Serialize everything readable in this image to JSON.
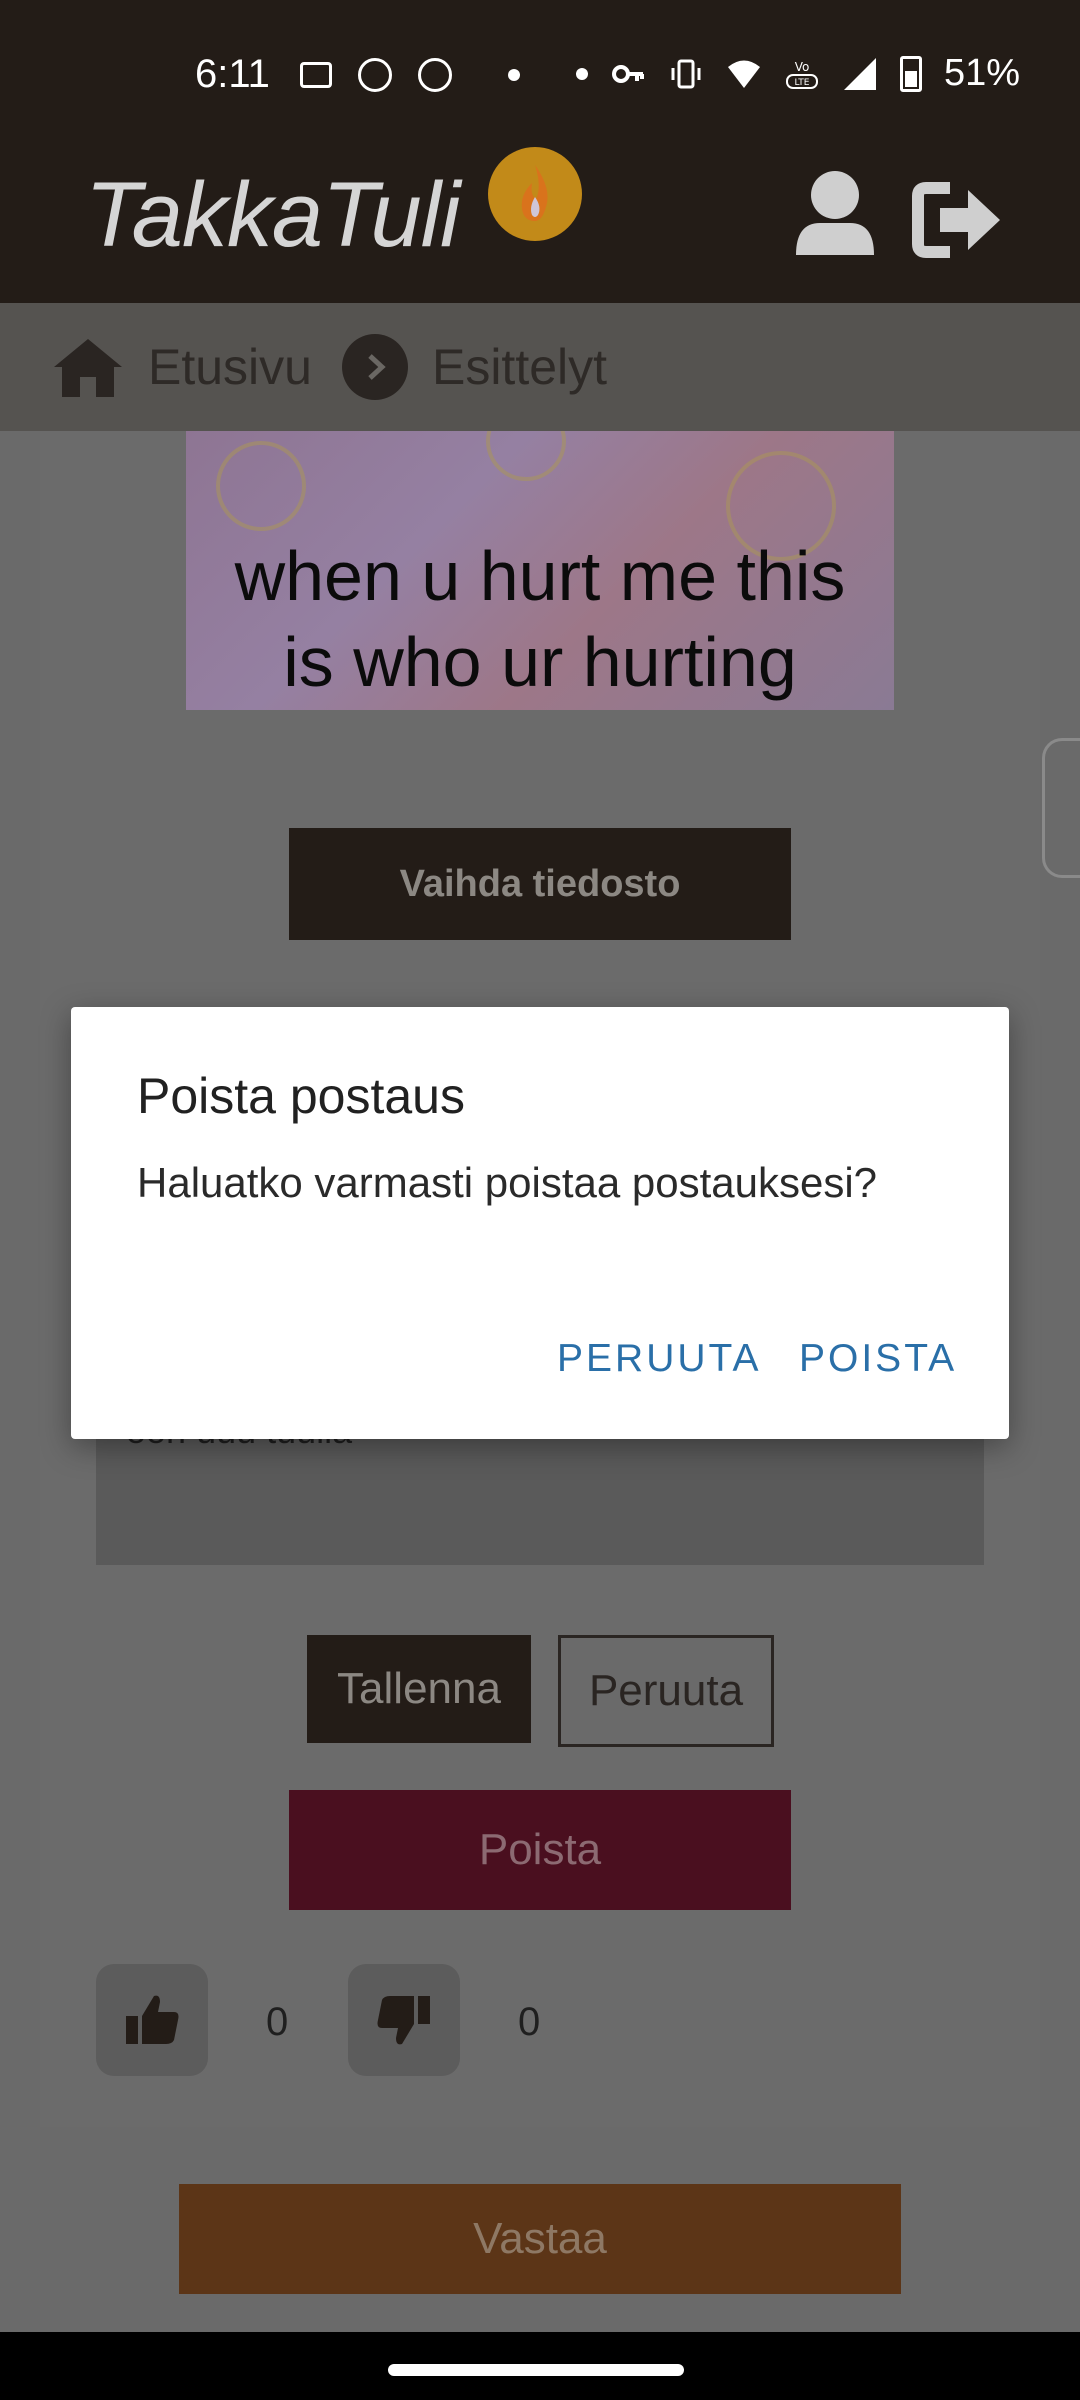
{
  "status_bar": {
    "time": "6:11",
    "battery": "51%"
  },
  "header": {
    "logo": "TakkaTuli"
  },
  "breadcrumb": {
    "home": "Etusivu",
    "current": "Esittelyt"
  },
  "post": {
    "image_caption_line1": "when u hurt me this",
    "image_caption_line2": "is who ur hurting",
    "change_file_label": "Vaihda tiedosto",
    "text_value": "ooh uuu tuulla",
    "save_label": "Tallenna",
    "cancel_label": "Peruuta",
    "delete_label": "Poista",
    "likes": "0",
    "dislikes": "0"
  },
  "reply_label": "Vastaa",
  "dialog": {
    "title": "Poista postaus",
    "message": "Haluatko varmasti poistaa postauksesi?",
    "cancel_label": "PERUUTA",
    "confirm_label": "POISTA"
  },
  "colors": {
    "header_bg": "#231c17",
    "delete_red": "#4a0f1f",
    "reply_orange": "#5c3517",
    "dialog_button_blue": "#2a6fa8"
  }
}
